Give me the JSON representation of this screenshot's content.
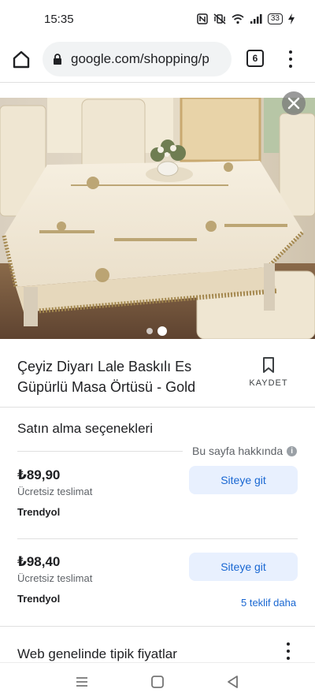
{
  "status_bar": {
    "time": "15:35",
    "battery": "33"
  },
  "browser": {
    "url": "google.com/shopping/p",
    "tab_count": "6"
  },
  "product": {
    "title": "Çeyiz Diyarı Lale Baskılı Es Güpürlü Masa Örtüsü - Gold",
    "save_label": "KAYDET",
    "image_count": 2,
    "active_image_index": 1
  },
  "buying_options": {
    "heading": "Satın alma seçenekleri",
    "about_label": "Bu sayfa hakkında",
    "offers": [
      {
        "price": "₺89,90",
        "delivery": "Ücretsiz teslimat",
        "seller": "Trendyol",
        "button_label": "Siteye git"
      },
      {
        "price": "₺98,40",
        "delivery": "Ücretsiz teslimat",
        "seller": "Trendyol",
        "button_label": "Siteye git"
      }
    ],
    "more_offers_label": "5 teklif daha"
  },
  "typical_prices": {
    "heading": "Web genelinde tipik fiyatlar"
  },
  "colors": {
    "link_blue": "#1967d2",
    "button_bg": "#e8f0fe",
    "text_primary": "#202124",
    "text_secondary": "#5f6368"
  },
  "icons": {
    "home": "home-icon",
    "lock": "lock-icon",
    "menu": "more-vert-icon",
    "close": "close-icon",
    "bookmark": "bookmark-icon",
    "info": "info-icon",
    "nav_recents": "recents-icon",
    "nav_home": "square-home-icon",
    "nav_back": "back-triangle-icon"
  }
}
